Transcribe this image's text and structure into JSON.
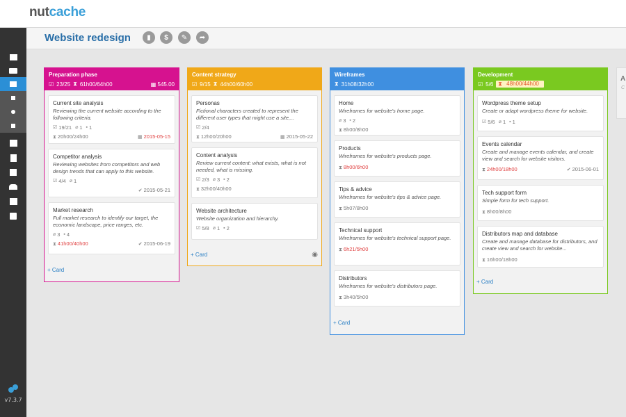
{
  "app": {
    "logo_left": "nut",
    "logo_right": "cache",
    "version": "v7.3.7"
  },
  "project": {
    "title": "Website redesign"
  },
  "header_buttons": [
    {
      "name": "stats-icon",
      "glyph": "▮"
    },
    {
      "name": "dollar-icon",
      "glyph": "$"
    },
    {
      "name": "edit-icon",
      "glyph": "✎"
    },
    {
      "name": "share-icon",
      "glyph": "➦"
    }
  ],
  "add_card_label": "+ Card",
  "lists": [
    {
      "title": "Preparation phase",
      "color": "#d6128f",
      "tasks": "23/25",
      "time": "61h00/64h00",
      "amount": "545.00",
      "cards": [
        {
          "title": "Current site analysis",
          "desc": "Reviewing the current website according to the following criteria.",
          "checklist": "19/21",
          "attachments": "1",
          "comments": "1",
          "time": "20h00/24h00",
          "due": "2015-05-15",
          "due_red": true
        },
        {
          "title": "Competitor analysis",
          "desc": "Reviewing websites from competitors and web design trends that can apply to this website.",
          "checklist": "4/4",
          "attachments": "1",
          "due": "2015-05-21",
          "done": true
        },
        {
          "title": "Market research",
          "desc": "Full market research to identify our target, the economic landscape, price ranges, etc.",
          "attachments": "3",
          "comments": "4",
          "time": "41h00/40h00",
          "time_red": true,
          "due": "2015-06-19",
          "done": true
        }
      ]
    },
    {
      "title": "Content strategy",
      "color": "#f0a818",
      "tasks": "9/15",
      "time": "44h00/60h00",
      "cards": [
        {
          "title": "Personas",
          "desc": "Fictional characters created to represent the different user types that might use a site,...",
          "checklist": "2/4",
          "time": "12h00/20h00",
          "due": "2015-05-22"
        },
        {
          "title": "Content analysis",
          "desc": "Review current content: what exists, what is not needed, what is missing.",
          "checklist": "2/3",
          "attachments": "3",
          "comments": "2",
          "time": "32h00/40h00"
        },
        {
          "title": "Website architecture",
          "desc": "Website organization and hierarchy.",
          "checklist": "5/8",
          "attachments": "1",
          "comments": "2"
        }
      ]
    },
    {
      "title": "Wireframes",
      "color": "#3f8fe0",
      "time": "31h08/32h00",
      "cards": [
        {
          "title": "Home",
          "desc": "Wireframes for website's home page.",
          "time": "8h00/8h00"
        },
        {
          "title": "Products",
          "desc": "Wireframes for website's products page.",
          "time": "8h00/6h00",
          "time_red": true
        },
        {
          "title": "Tips & advice",
          "desc": "Wireframes for website's tips & advice page.",
          "time": "5h07/8h00"
        },
        {
          "title": "Technical support",
          "desc": "Wireframes for website's technical support page.",
          "time": "6h21/5h00",
          "time_red": true
        },
        {
          "title": "Distributors",
          "desc": "Wireframes for website's distributors page.",
          "time": "3h40/5h00"
        }
      ]
    },
    {
      "title": "Development",
      "color": "#7ac920",
      "tasks": "5/6",
      "time": "48h00/44h00",
      "time_warn": true,
      "cards": [
        {
          "title": "Wordpress theme setup",
          "desc": "Create or adapt wordpress theme for website.",
          "checklist": "5/6",
          "attachments": "1",
          "comments": "1"
        },
        {
          "title": "Events calendar",
          "desc": "Create and manage events calendar, and create view and search for website visitors.",
          "time": "24h00/18h00",
          "time_red": true,
          "due": "2015-06-01",
          "done": true
        },
        {
          "title": "Tech support form",
          "desc": "Simple form for tech support.",
          "time": "8h00/8h00"
        },
        {
          "title": "Distributors map and database",
          "desc": "Create and manage database for distributors, and create view and search for website...",
          "time": "16h00/18h00"
        }
      ]
    }
  ],
  "partial_list": {
    "initial": "A",
    "desc_initial": "C"
  }
}
